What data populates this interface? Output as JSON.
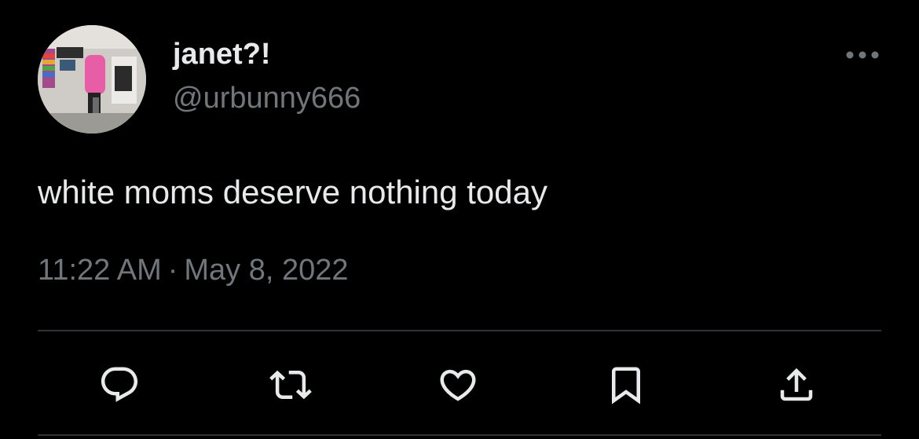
{
  "tweet": {
    "display_name": "janet?!",
    "handle": "@urbunny666",
    "text": "white moms deserve nothing today",
    "time": "11:22 AM",
    "separator": "·",
    "date": "May 8, 2022"
  },
  "icons": {
    "more": "more-options-icon",
    "reply": "reply-icon",
    "retweet": "retweet-icon",
    "like": "heart-icon",
    "bookmark": "bookmark-icon",
    "share": "share-icon"
  },
  "colors": {
    "background": "#000000",
    "primary_text": "#e7e9ea",
    "secondary_text": "#71767b",
    "divider": "#2f3336"
  }
}
